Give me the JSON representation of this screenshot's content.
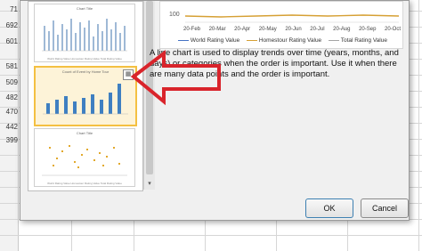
{
  "sheet": {
    "row_values": [
      "71",
      "692",
      "601",
      "581",
      "509",
      "482",
      "470",
      "442",
      "399"
    ]
  },
  "dialog": {
    "preview": {
      "y_tick": "100",
      "x_ticks": [
        "20-Feb",
        "20-Mar",
        "20-Apr",
        "20-May",
        "20-Jun",
        "20-Jul",
        "20-Aug",
        "20-Sep",
        "20-Oct"
      ],
      "legend": [
        "World Rating Value",
        "Homestour Rating Value",
        "Total Rating Value"
      ],
      "series_colors": [
        "#4472c4",
        "#d6a034",
        "#a5a5a5"
      ]
    },
    "thumbnails": [
      {
        "title": "Chart Title",
        "legend": "World Rating Value  Homestour Rating Value  Total Rating Value"
      },
      {
        "title": "Count of Event by Home Tour",
        "legend": ""
      },
      {
        "title": "Chart Title",
        "legend": "World Rating Value  Homestour Rating Value  Total Rating Value"
      }
    ],
    "description": "A line chart is used to display trends over time (years, months, and days) or categories when the order is important. Use it when there are many data points and the order is important.",
    "ok_label": "OK",
    "cancel_label": "Cancel"
  },
  "colors": {
    "accent_arrow": "#d9242b",
    "bar": "#3f7fc1",
    "scatter": "#e2a92c",
    "selection": "#f4c042"
  }
}
